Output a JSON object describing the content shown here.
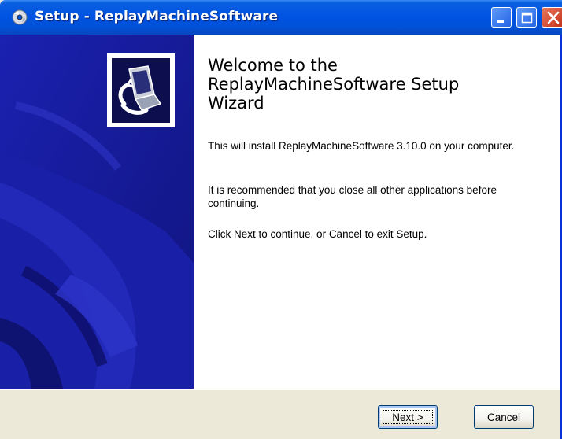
{
  "window": {
    "title": "Setup - ReplayMachineSoftware",
    "icons": {
      "app": "setup-disc-icon",
      "minimize": "minimize-icon",
      "maximize": "maximize-icon",
      "close": "close-icon"
    }
  },
  "welcome": {
    "title_line1": "Welcome to the",
    "title_line2": "ReplayMachineSoftware Setup",
    "title_line3": "Wizard",
    "para1": "This will install ReplayMachineSoftware 3.10.0 on your computer.",
    "para2": "It is recommended that you close all other applications before continuing.",
    "para3": "Click Next to continue, or Cancel to exit Setup."
  },
  "buttons": {
    "next_mnemonic": "N",
    "next_rest": "ext >",
    "cancel": "Cancel"
  },
  "colors": {
    "titlebar": "#0054e3",
    "wizard_panel": "#15199e",
    "dialog_bg": "#ece9d8"
  }
}
